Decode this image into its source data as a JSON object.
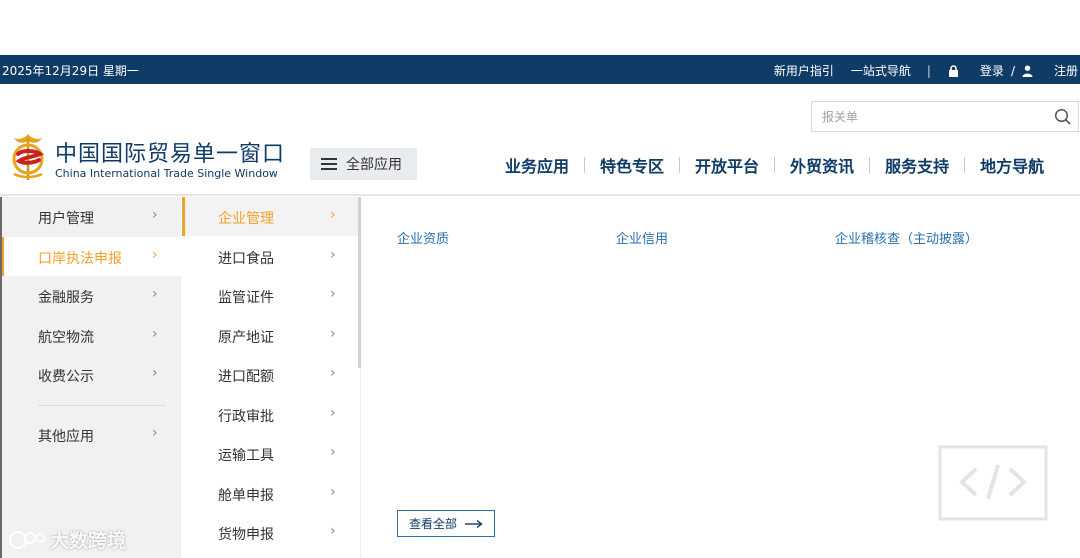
{
  "topbar": {
    "date": "2025年12月29日 星期一",
    "guide": "新用户指引",
    "one_stop": "一站式导航",
    "separator": "|",
    "login": "登录",
    "slash": "/",
    "register": "注册"
  },
  "search": {
    "placeholder": "报关单"
  },
  "logo": {
    "title_cn": "中国国际贸易单一窗口",
    "title_en": "China International Trade Single Window"
  },
  "all_apps": "全部应用",
  "nav": [
    "业务应用",
    "特色专区",
    "开放平台",
    "外贸资讯",
    "服务支持",
    "地方导航"
  ],
  "left_menu": [
    {
      "label": "用户管理"
    },
    {
      "label": "口岸执法申报"
    },
    {
      "label": "金融服务"
    },
    {
      "label": "航空物流"
    },
    {
      "label": "收费公示"
    },
    {
      "label": "其他应用"
    }
  ],
  "sub_menu": [
    {
      "label": "企业管理"
    },
    {
      "label": "进口食品"
    },
    {
      "label": "监管证件"
    },
    {
      "label": "原产地证"
    },
    {
      "label": "进口配额"
    },
    {
      "label": "行政审批"
    },
    {
      "label": "运输工具"
    },
    {
      "label": "舱单申报"
    },
    {
      "label": "货物申报"
    }
  ],
  "chevron": "›",
  "content_links": [
    "企业资质",
    "企业信用",
    "企业稽核查（主动披露）"
  ],
  "view_all": "查看全部",
  "watermark": "大数跨境",
  "colors": {
    "top_bar": "#0f3b67",
    "accent": "#f0a12a",
    "link": "#2a6fb0",
    "nav_text": "#0f3b67"
  },
  "icons": [
    "menu-icon",
    "search-icon",
    "lock-icon",
    "user-icon",
    "chevron-right-icon",
    "arrow-right-icon",
    "code-icon",
    "logo-emblem"
  ]
}
